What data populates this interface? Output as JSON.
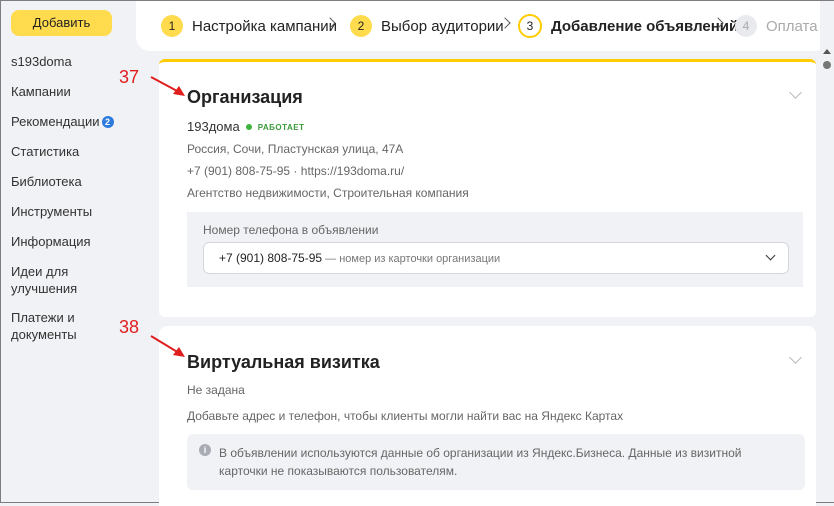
{
  "sidebar": {
    "add_button": "Добавить",
    "account": "s193doma",
    "items": [
      {
        "label": "Кампании"
      },
      {
        "label": "Рекомендации",
        "badge": "2"
      },
      {
        "label": "Статистика"
      },
      {
        "label": "Библиотека"
      },
      {
        "label": "Инструменты"
      },
      {
        "label": "Информация"
      },
      {
        "label": "Идеи для улучшения"
      },
      {
        "label": "Платежи и документы"
      }
    ]
  },
  "steps": [
    {
      "number": "1",
      "label": "Настройка кампании",
      "state": "done"
    },
    {
      "number": "2",
      "label": "Выбор аудитории",
      "state": "done"
    },
    {
      "number": "3",
      "label": "Добавление объявлений",
      "state": "current"
    },
    {
      "number": "4",
      "label": "Оплата",
      "state": "disabled"
    }
  ],
  "annotations": {
    "first": "37",
    "second": "38",
    "color": "#e01e1e"
  },
  "organization": {
    "title": "Организация",
    "name": "193дома",
    "status": "РАБОТАЕТ",
    "address": "Россия, Сочи, Пластунская улица, 47А",
    "phone": "+7 (901) 808-75-95",
    "separator": "·",
    "site": "https://193doma.ru/",
    "categories": "Агентство недвижимости, Строительная компания",
    "phone_field": {
      "label": "Номер телефона в объявлении",
      "value": "+7 (901) 808-75-95",
      "hint": " — номер из карточки организации"
    }
  },
  "virtual_card": {
    "title": "Виртуальная визитка",
    "state": "Не задана",
    "description": "Добавьте адрес и телефон, чтобы клиенты могли найти вас на Яндекс Картах",
    "info_icon": "i",
    "info_text": "В объявлении используются данные об организации из Яндекс.Бизнеса. Данные из визитной карточки не показываются пользователям."
  },
  "colors": {
    "accent": "#ffdb4d",
    "status": "#3fb33f",
    "badge": "#2d7bdf"
  }
}
